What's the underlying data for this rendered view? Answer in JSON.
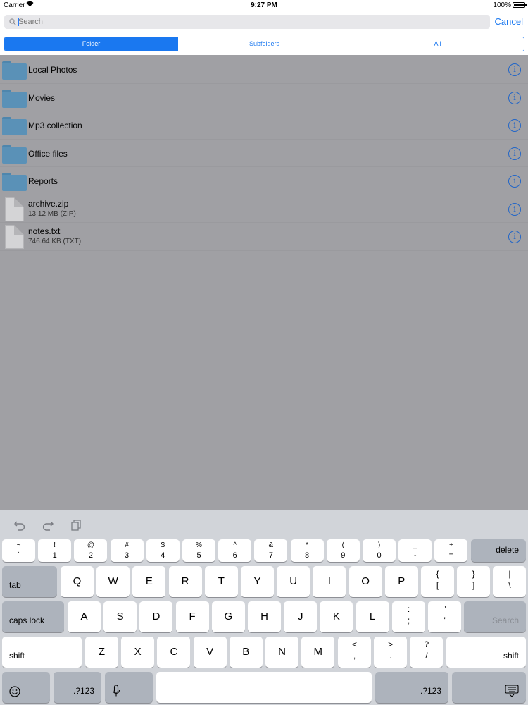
{
  "status_bar": {
    "carrier": "Carrier",
    "time": "9:27 PM",
    "battery": "100%",
    "battery_level": 1.0
  },
  "search": {
    "placeholder": "Search",
    "value": "",
    "cancel_label": "Cancel"
  },
  "segments": [
    {
      "label": "Folder",
      "selected": true
    },
    {
      "label": "Subfolders",
      "selected": false
    },
    {
      "label": "All",
      "selected": false
    }
  ],
  "items": [
    {
      "type": "folder",
      "name": "Local Photos"
    },
    {
      "type": "folder",
      "name": "Movies"
    },
    {
      "type": "folder",
      "name": "Mp3 collection"
    },
    {
      "type": "folder",
      "name": "Office files"
    },
    {
      "type": "folder",
      "name": "Reports"
    },
    {
      "type": "file",
      "name": "archive.zip",
      "detail": "13.12  MB (ZIP)"
    },
    {
      "type": "file",
      "name": "notes.txt",
      "detail": "746.64  KB (TXT)"
    }
  ],
  "keyboard": {
    "tools": [
      "undo-icon",
      "redo-icon",
      "paste-icon"
    ],
    "number_row": [
      {
        "top": "~",
        "bottom": "`"
      },
      {
        "top": "!",
        "bottom": "1"
      },
      {
        "top": "@",
        "bottom": "2"
      },
      {
        "top": "#",
        "bottom": "3"
      },
      {
        "top": "$",
        "bottom": "4"
      },
      {
        "top": "%",
        "bottom": "5"
      },
      {
        "top": "^",
        "bottom": "6"
      },
      {
        "top": "&",
        "bottom": "7"
      },
      {
        "top": "*",
        "bottom": "8"
      },
      {
        "top": "(",
        "bottom": "9"
      },
      {
        "top": ")",
        "bottom": "0"
      },
      {
        "top": "_",
        "bottom": "-"
      },
      {
        "top": "+",
        "bottom": "="
      }
    ],
    "delete_label": "delete",
    "tab_label": "tab",
    "row_q": [
      "Q",
      "W",
      "E",
      "R",
      "T",
      "Y",
      "U",
      "I",
      "O",
      "P"
    ],
    "row_q_extra": [
      {
        "top": "{",
        "bottom": "["
      },
      {
        "top": "}",
        "bottom": "]"
      },
      {
        "top": "|",
        "bottom": "\\"
      }
    ],
    "caps_label": "caps lock",
    "row_a": [
      "A",
      "S",
      "D",
      "F",
      "G",
      "H",
      "J",
      "K",
      "L"
    ],
    "row_a_extra": [
      {
        "top": ":",
        "bottom": ";"
      },
      {
        "top": "\"",
        "bottom": "'"
      }
    ],
    "search_key_label": "Search",
    "shift_label": "shift",
    "row_z": [
      "Z",
      "X",
      "C",
      "V",
      "B",
      "N",
      "M"
    ],
    "row_z_extra": [
      {
        "top": "<",
        "bottom": ","
      },
      {
        "top": ">",
        "bottom": "."
      },
      {
        "top": "?",
        "bottom": "/"
      }
    ],
    "numbers_label": ".?123",
    "emoji_icon": "emoji-icon",
    "mic_icon": "microphone-icon",
    "hide_icon": "keyboard-dismiss-icon"
  }
}
